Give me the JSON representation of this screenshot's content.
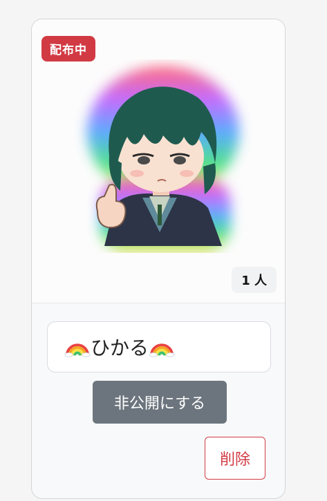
{
  "card": {
    "status_badge": "配布中",
    "count_badge": "1 人",
    "sticker_name": "ひかる",
    "sticker_name_prefix_icon": "rainbow-emoji",
    "sticker_name_suffix_icon": "rainbow-emoji",
    "make_private_label": "非公開にする",
    "delete_label": "削除"
  },
  "colors": {
    "danger": "#d23a43",
    "secondary": "#6c757d"
  }
}
